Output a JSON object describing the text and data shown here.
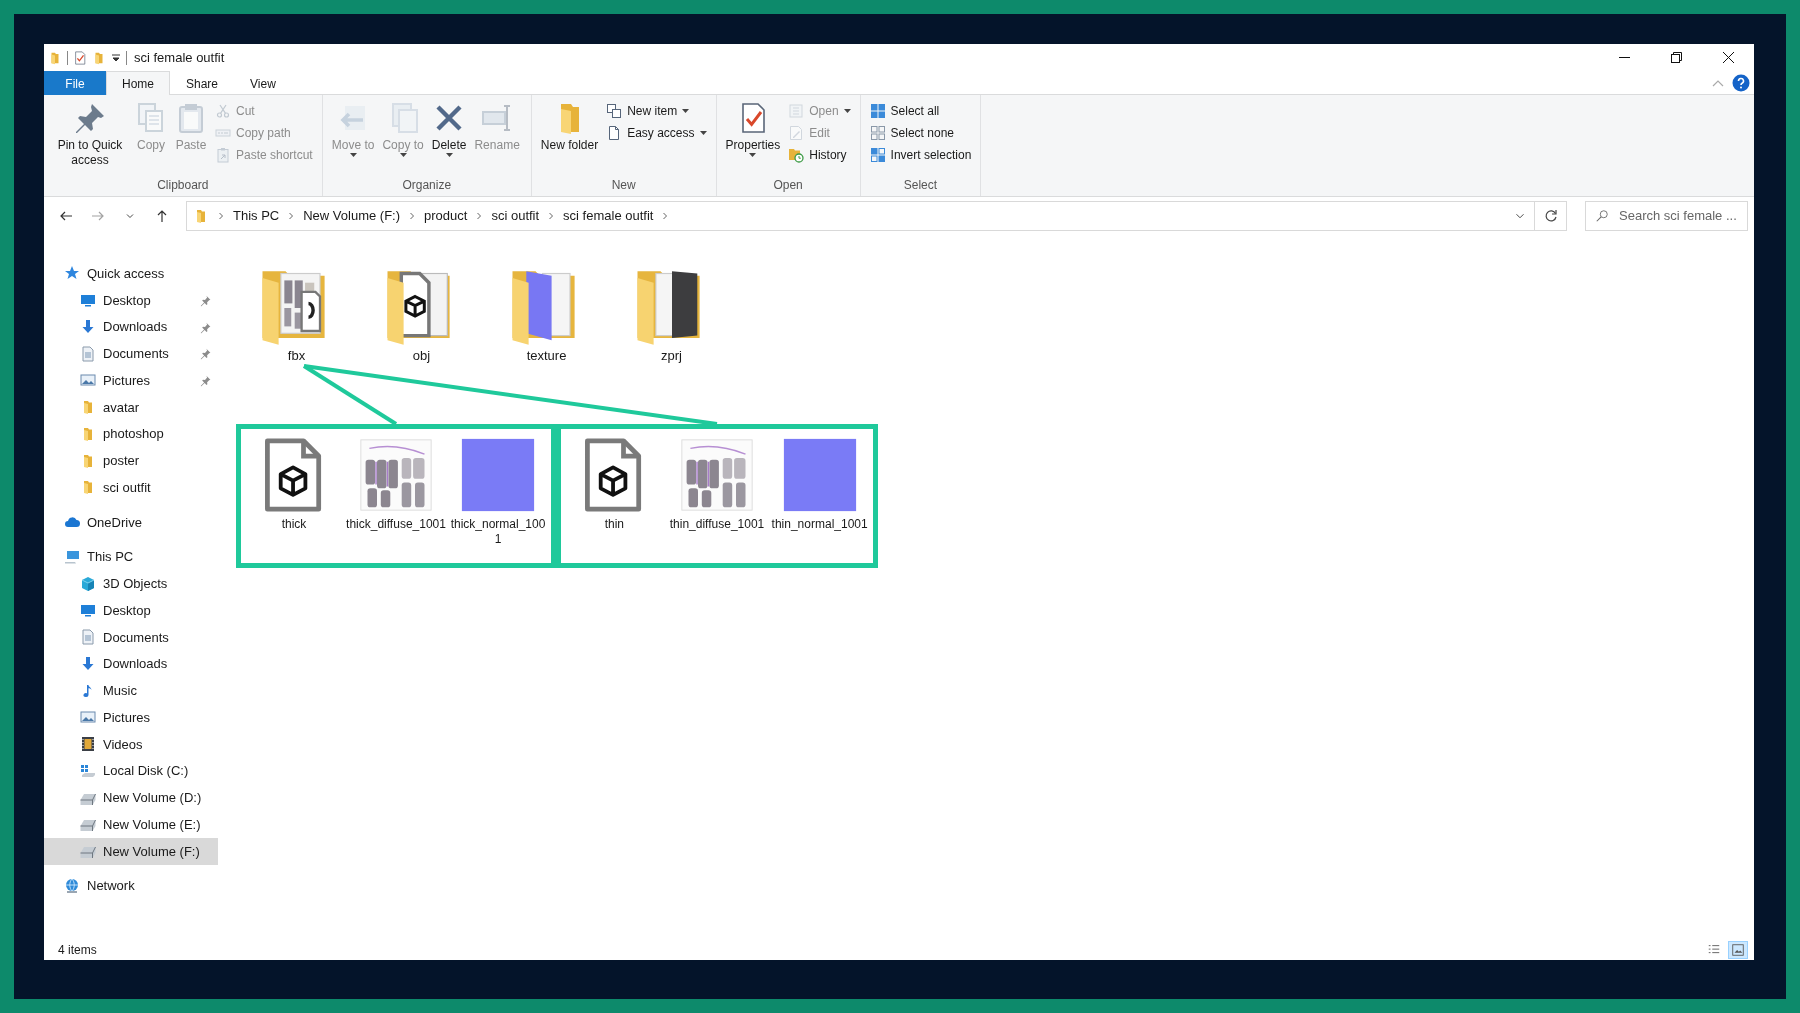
{
  "window": {
    "title": "sci female outfit"
  },
  "ribbon_tabs": [
    {
      "label": "File",
      "kind": "backstage",
      "selected": false
    },
    {
      "label": "Home",
      "kind": "tab",
      "selected": true
    },
    {
      "label": "Share",
      "kind": "tab",
      "selected": false
    },
    {
      "label": "View",
      "kind": "tab",
      "selected": false
    }
  ],
  "ribbon_groups": [
    {
      "label": "Clipboard",
      "buttons": [
        {
          "label": "Pin to Quick access",
          "kind": "large",
          "disabled": false,
          "dropdown": false
        },
        {
          "label": "Copy",
          "kind": "large",
          "disabled": true,
          "dropdown": false
        },
        {
          "label": "Paste",
          "kind": "large",
          "disabled": true,
          "dropdown": false
        },
        {
          "label": "Cut",
          "kind": "small",
          "disabled": true,
          "dropdown": false
        },
        {
          "label": "Copy path",
          "kind": "small",
          "disabled": true,
          "dropdown": false
        },
        {
          "label": "Paste shortcut",
          "kind": "small",
          "disabled": true,
          "dropdown": false
        }
      ]
    },
    {
      "label": "Organize",
      "buttons": [
        {
          "label": "Move to",
          "kind": "large",
          "disabled": true,
          "dropdown": true
        },
        {
          "label": "Copy to",
          "kind": "large",
          "disabled": true,
          "dropdown": true
        },
        {
          "label": "Delete",
          "kind": "large",
          "disabled": false,
          "dropdown": true
        },
        {
          "label": "Rename",
          "kind": "large",
          "disabled": true,
          "dropdown": false
        }
      ]
    },
    {
      "label": "New",
      "buttons": [
        {
          "label": "New folder",
          "kind": "large",
          "disabled": false,
          "dropdown": false
        },
        {
          "label": "New item",
          "kind": "small",
          "disabled": false,
          "dropdown": true
        },
        {
          "label": "Easy access",
          "kind": "small",
          "disabled": false,
          "dropdown": true
        }
      ]
    },
    {
      "label": "Open",
      "buttons": [
        {
          "label": "Properties",
          "kind": "large",
          "disabled": false,
          "dropdown": true
        },
        {
          "label": "Open",
          "kind": "small",
          "disabled": true,
          "dropdown": true
        },
        {
          "label": "Edit",
          "kind": "small",
          "disabled": true,
          "dropdown": false
        },
        {
          "label": "History",
          "kind": "small",
          "disabled": false,
          "dropdown": false
        }
      ]
    },
    {
      "label": "Select",
      "buttons": [
        {
          "label": "Select all",
          "kind": "small",
          "disabled": false,
          "dropdown": false
        },
        {
          "label": "Select none",
          "kind": "small",
          "disabled": false,
          "dropdown": false
        },
        {
          "label": "Invert selection",
          "kind": "small",
          "disabled": false,
          "dropdown": false
        }
      ]
    }
  ],
  "nav_buttons": [
    {
      "kind": "back",
      "disabled": false
    },
    {
      "kind": "forward",
      "disabled": true
    },
    {
      "kind": "recent",
      "disabled": false
    },
    {
      "kind": "up",
      "disabled": false
    }
  ],
  "breadcrumbs": [
    "This PC",
    "New Volume (F:)",
    "product",
    "sci outfit",
    "sci female outfit"
  ],
  "search": {
    "placeholder": "Search sci female ..."
  },
  "sidebar": [
    {
      "label": "Quick access",
      "selected": false,
      "children": [
        {
          "label": "Desktop",
          "pinned": true,
          "selected": false
        },
        {
          "label": "Downloads",
          "pinned": true,
          "selected": false
        },
        {
          "label": "Documents",
          "pinned": true,
          "selected": false
        },
        {
          "label": "Pictures",
          "pinned": true,
          "selected": false
        },
        {
          "label": "avatar",
          "pinned": false,
          "selected": false
        },
        {
          "label": "photoshop",
          "pinned": false,
          "selected": false
        },
        {
          "label": "poster",
          "pinned": false,
          "selected": false
        },
        {
          "label": "sci outfit",
          "pinned": false,
          "selected": false
        }
      ]
    },
    {
      "label": "OneDrive",
      "selected": false
    },
    {
      "label": "This PC",
      "selected": false,
      "children": [
        {
          "label": "3D Objects",
          "pinned": false,
          "selected": false
        },
        {
          "label": "Desktop",
          "pinned": false,
          "selected": false
        },
        {
          "label": "Documents",
          "pinned": false,
          "selected": false
        },
        {
          "label": "Downloads",
          "pinned": false,
          "selected": false
        },
        {
          "label": "Music",
          "pinned": false,
          "selected": false
        },
        {
          "label": "Pictures",
          "pinned": false,
          "selected": false
        },
        {
          "label": "Videos",
          "pinned": false,
          "selected": false
        },
        {
          "label": "Local Disk (C:)",
          "pinned": false,
          "selected": false
        },
        {
          "label": "New Volume (D:)",
          "pinned": false,
          "selected": false
        },
        {
          "label": "New Volume (E:)",
          "pinned": false,
          "selected": false
        },
        {
          "label": "New Volume (F:)",
          "pinned": false,
          "selected": true
        }
      ]
    },
    {
      "label": "Network",
      "selected": false
    }
  ],
  "folders": [
    {
      "name": "fbx"
    },
    {
      "name": "obj"
    },
    {
      "name": "texture"
    },
    {
      "name": "zprj"
    }
  ],
  "file_groups": [
    {
      "files": [
        {
          "name": "thick",
          "kind": "model"
        },
        {
          "name": "thick_diffuse_1001",
          "kind": "diffuse"
        },
        {
          "name": "thick_normal_1001",
          "kind": "normal"
        }
      ]
    },
    {
      "files": [
        {
          "name": "thin",
          "kind": "model"
        },
        {
          "name": "thin_diffuse_1001",
          "kind": "diffuse"
        },
        {
          "name": "thin_normal_1001",
          "kind": "normal"
        }
      ]
    }
  ],
  "status_bar": {
    "text": "4 items",
    "views": [
      {
        "kind": "details",
        "selected": false
      },
      {
        "kind": "large-icons",
        "selected": true
      }
    ]
  }
}
